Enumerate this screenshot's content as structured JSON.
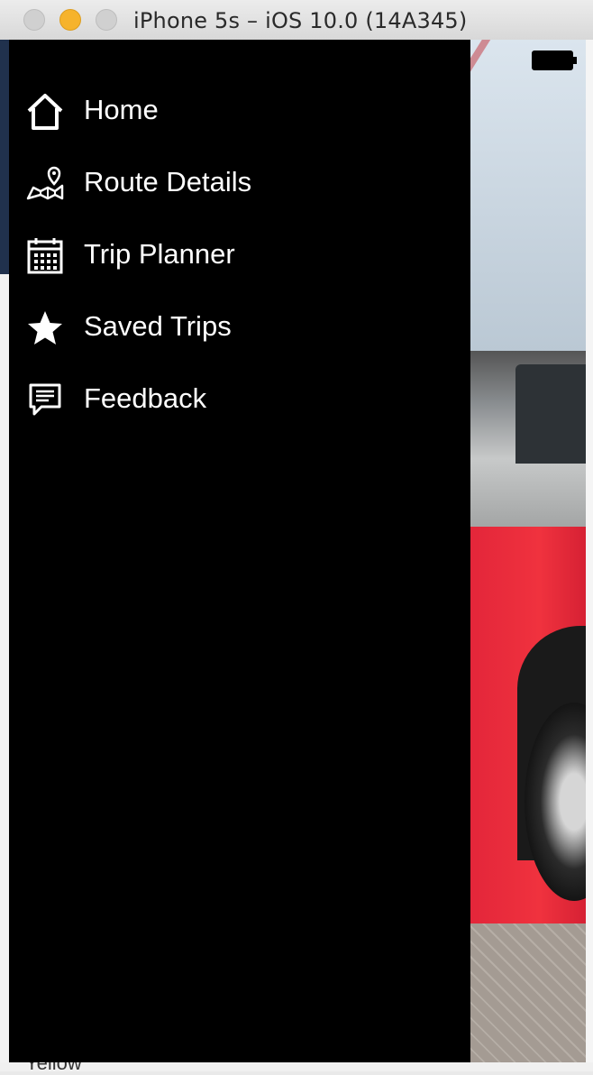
{
  "window": {
    "title": "iPhone 5s – iOS 10.0 (14A345)"
  },
  "menu": {
    "items": [
      {
        "label": "Home",
        "icon": "home-icon"
      },
      {
        "label": "Route Details",
        "icon": "map-pin-icon"
      },
      {
        "label": "Trip Planner",
        "icon": "calendar-icon"
      },
      {
        "label": "Saved Trips",
        "icon": "star-icon"
      },
      {
        "label": "Feedback",
        "icon": "feedback-icon"
      }
    ]
  },
  "background": {
    "peek_text": "Yellow"
  },
  "colors": {
    "drawer_bg": "#000000",
    "menu_text": "#ffffff",
    "minimize_light": "#f6b32c"
  }
}
